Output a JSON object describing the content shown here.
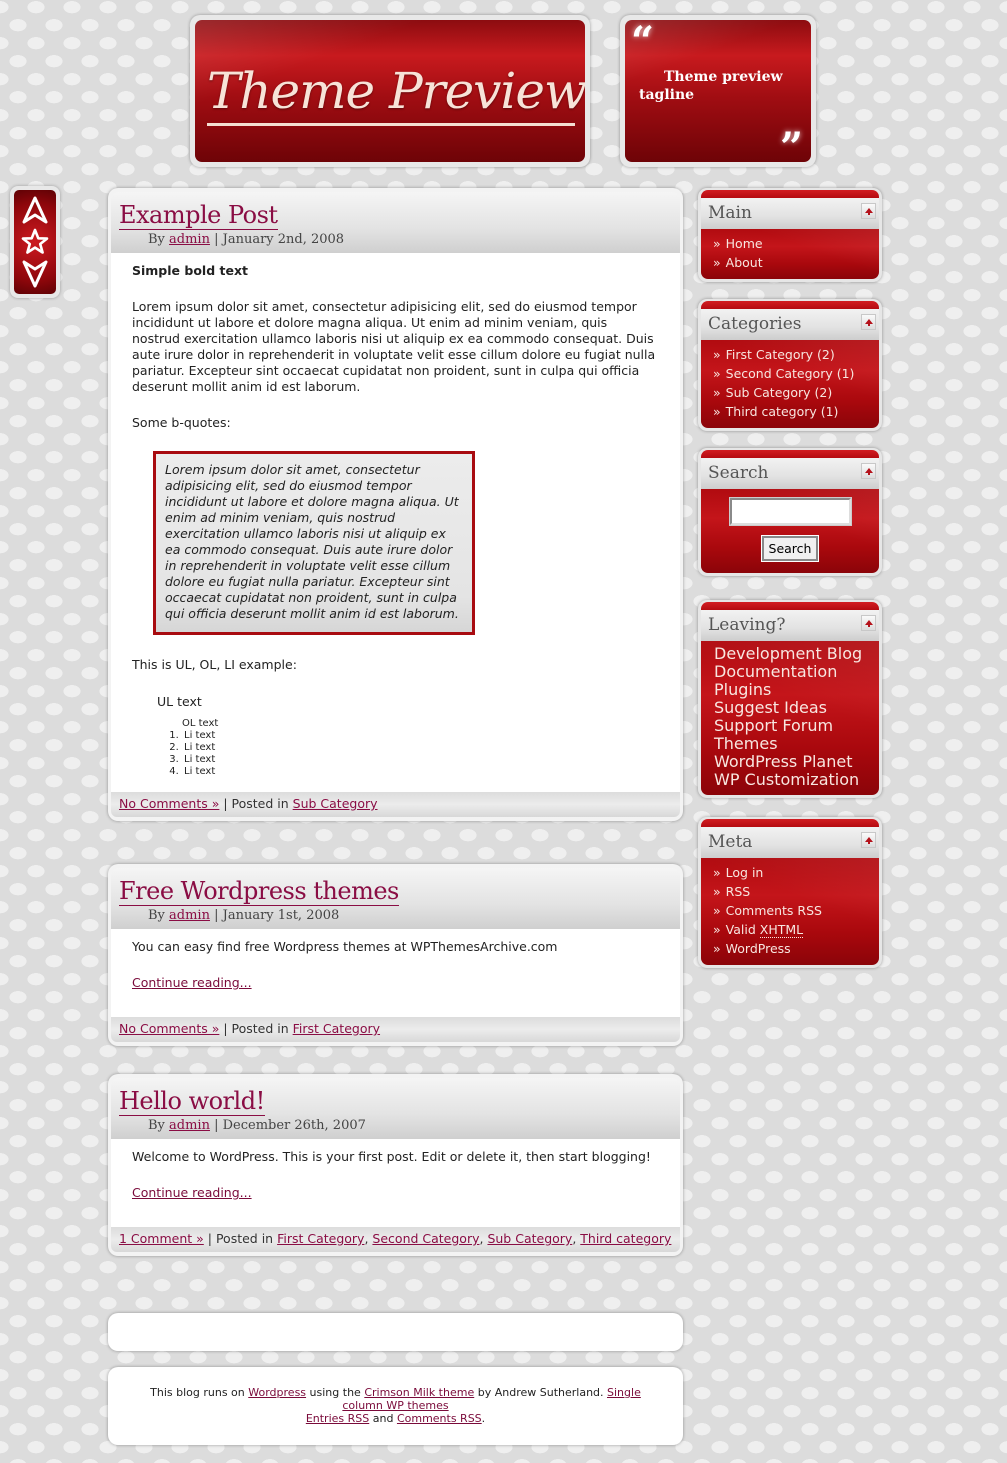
{
  "header": {
    "site_title": "Theme Preview",
    "tagline": "Theme preview tagline",
    "quote_open": "“",
    "quote_close": "”"
  },
  "side_nav": {
    "icons": [
      "arrow-up-icon",
      "star-icon",
      "arrow-down-icon"
    ]
  },
  "posts": [
    {
      "title": "Example Post",
      "by": "By ",
      "author": "admin",
      "date": " | January 2nd, 2008",
      "bold_text": "Simple bold text",
      "paragraph": "Lorem ipsum dolor sit amet, consectetur adipisicing elit, sed do eiusmod tempor incididunt ut labore et dolore magna aliqua. Ut enim ad minim veniam, quis nostrud exercitation ullamco laboris nisi ut aliquip ex ea commodo consequat. Duis aute irure dolor in reprehenderit in voluptate velit esse cillum dolore eu fugiat nulla pariatur. Excepteur sint occaecat cupidatat non proident, sunt in culpa qui officia deserunt mollit anim id est laborum.",
      "bquote_intro": "Some b-quotes:",
      "blockquote": "Lorem ipsum dolor sit amet, consectetur adipisicing elit, sed do eiusmod tempor incididunt ut labore et dolore magna aliqua. Ut enim ad minim veniam, quis nostrud exercitation ullamco laboris nisi ut aliquip ex ea commodo consequat. Duis aute irure dolor in reprehenderit in voluptate velit esse cillum dolore eu fugiat nulla pariatur. Excepteur sint occaecat cupidatat non proident, sunt in culpa qui officia deserunt mollit anim id est laborum.",
      "list_intro": "This is UL, OL, LI example:",
      "ul_text": "UL text",
      "ol_text": "OL text",
      "li_items": [
        "Li text",
        "Li text",
        "Li text",
        "Li text"
      ],
      "comments_link": "No Comments »",
      "posted_in": " | Posted in ",
      "categories": [
        "Sub Category"
      ]
    },
    {
      "title": "Free Wordpress themes",
      "by": "By ",
      "author": "admin",
      "date": " | January 1st, 2008",
      "paragraph": "You can easy find free Wordpress themes at WPThemesArchive.com",
      "continue": "Continue reading...",
      "comments_link": "No Comments »",
      "posted_in": " | Posted in ",
      "categories": [
        "First Category"
      ]
    },
    {
      "title": "Hello world!",
      "by": "By ",
      "author": "admin",
      "date": " | December 26th, 2007",
      "paragraph": "Welcome to WordPress. This is your first post. Edit or delete it, then start blogging!",
      "continue": "Continue reading...",
      "comments_link": "1 Comment »",
      "posted_in": " | Posted in ",
      "categories": [
        "First Category",
        "Second Category",
        "Sub Category",
        "Third category"
      ],
      "separator": ", "
    }
  ],
  "footer": {
    "t1": "This blog runs on ",
    "wordpress": "Wordpress",
    "t2": " using the ",
    "theme": "Crimson Milk theme",
    "t3": " by Andrew Sutherland. ",
    "single": "Single column WP themes",
    "entries_rss": "Entries RSS",
    "and": " and ",
    "comments_rss": "Comments RSS",
    "period": "."
  },
  "sidebar": {
    "raquo": "»",
    "main": {
      "title": "Main",
      "items": [
        "Home",
        "About"
      ]
    },
    "categories": {
      "title": "Categories",
      "items": [
        "First Category (2)",
        "Second Category (1)",
        "Sub Category (2)",
        "Third category (1)"
      ]
    },
    "search": {
      "title": "Search",
      "input_value": "",
      "button": "Search"
    },
    "leaving": {
      "title": "Leaving?",
      "items": [
        "Development Blog",
        "Documentation",
        "Plugins",
        "Suggest Ideas",
        "Support Forum",
        "Themes",
        "WordPress Planet",
        "WP Customization"
      ]
    },
    "meta": {
      "title": "Meta",
      "items": [
        "Log in",
        "RSS",
        "Comments RSS"
      ],
      "valid": "Valid ",
      "xhtml": "XHTML",
      "last": "WordPress"
    }
  },
  "colors": {
    "accent": "#b50b10",
    "link": "#8a0d44",
    "background": "#dcdcdc"
  }
}
